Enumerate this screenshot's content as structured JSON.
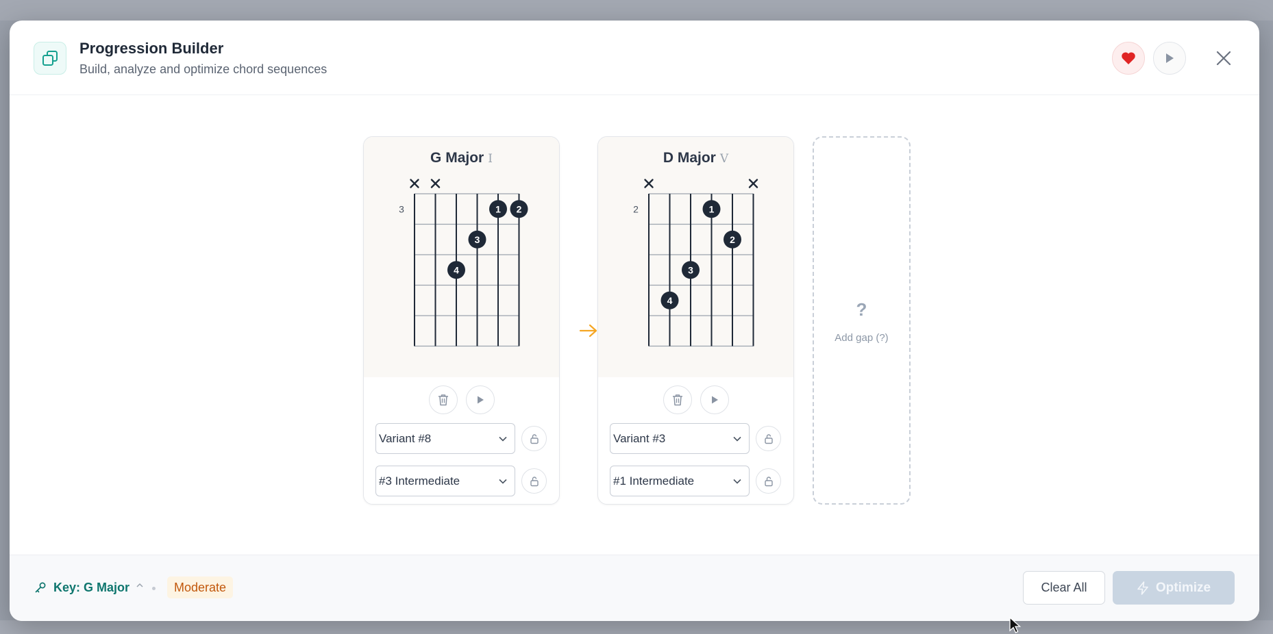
{
  "header": {
    "title": "Progression Builder",
    "subtitle": "Build, analyze and optimize chord sequences"
  },
  "chords": [
    {
      "name": "G Major",
      "numeral": "I",
      "base_fret": "3",
      "muted_strings": [
        1,
        2
      ],
      "fingers": [
        {
          "label": "1",
          "string": 5,
          "fret": 1
        },
        {
          "label": "2",
          "string": 6,
          "fret": 1
        },
        {
          "label": "3",
          "string": 4,
          "fret": 2
        },
        {
          "label": "4",
          "string": 3,
          "fret": 3
        }
      ],
      "variant": "Variant #8",
      "difficulty": "#3 Intermediate"
    },
    {
      "name": "D Major",
      "numeral": "V",
      "base_fret": "2",
      "muted_strings": [
        1,
        6
      ],
      "fingers": [
        {
          "label": "1",
          "string": 4,
          "fret": 1
        },
        {
          "label": "2",
          "string": 5,
          "fret": 2
        },
        {
          "label": "3",
          "string": 3,
          "fret": 3
        },
        {
          "label": "4",
          "string": 2,
          "fret": 4
        }
      ],
      "variant": "Variant #3",
      "difficulty": "#1 Intermediate"
    }
  ],
  "gap_slot": {
    "symbol": "?",
    "label": "Add gap (?)"
  },
  "footer": {
    "key_label": "Key: G Major",
    "difficulty_badge": "Moderate",
    "clear_label": "Clear All",
    "optimize_label": "Optimize"
  },
  "colors": {
    "accent": "#0f766e",
    "finger_dot": "#1f2937",
    "arrow": "#f5a623",
    "favorite": "#e02424"
  }
}
